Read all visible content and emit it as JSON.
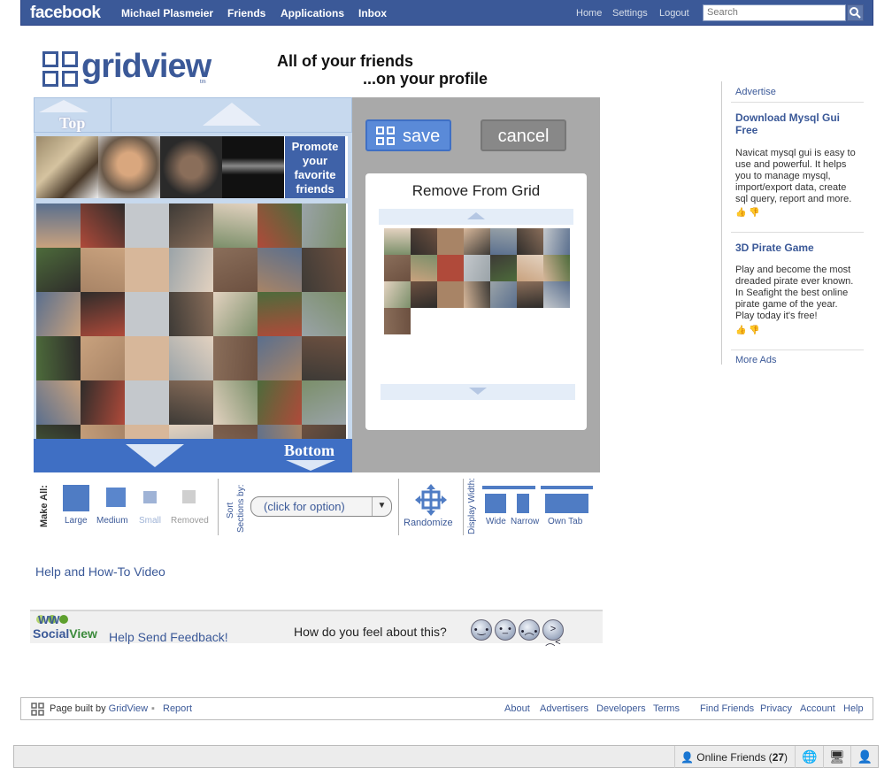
{
  "topbar": {
    "logo": "facebook",
    "nav": [
      "Michael Plasmeier",
      "Friends",
      "Applications",
      "Inbox"
    ],
    "right_nav": [
      "Home",
      "Settings",
      "Logout"
    ],
    "search_placeholder": "Search"
  },
  "app": {
    "logo_text": "gridview",
    "tm": "tm",
    "slogan_line1": "All of your friends",
    "slogan_line2": "...on your profile",
    "top_label": "Top",
    "bottom_label": "Bottom",
    "promote_text": "Promote your favorite friends",
    "save_label": "save",
    "cancel_label": "cancel",
    "remove_title": "Remove From Grid"
  },
  "controls": {
    "make_all_label": "Make All:",
    "sizes": [
      "Large",
      "Medium",
      "Small",
      "Removed"
    ],
    "sort_label_1": "Sort",
    "sort_label_2": "Sections by:",
    "sort_select": "(click for option)",
    "randomize_label": "Randomize",
    "display_width_label": "Display Width:",
    "widths": [
      "Wide",
      "Narrow",
      "Own Tab"
    ]
  },
  "help_link": "Help and How-To Video",
  "feedback": {
    "brand_social": "Social",
    "brand_view": "View",
    "help_text": "Help Send Feedback!",
    "question": "How do you feel about this?",
    "faces": [
      "happy-face-icon",
      "neutral-face-icon",
      "sad-face-icon",
      "angry-face-icon"
    ]
  },
  "sidebar": {
    "advertise": "Advertise",
    "ads": [
      {
        "title": "Download Mysql Gui Free",
        "body": "Navicat mysql gui is easy to use and powerful. It helps you to manage mysql, import/export data, create sql query, report and more."
      },
      {
        "title": "3D Pirate Game",
        "body": "Play and become the most dreaded pirate ever known. In Seafight the best online pirate game of the year. Play today it's free!"
      }
    ],
    "more_ads": "More Ads"
  },
  "footer": {
    "built_prefix": "Page built by",
    "built_link": "GridView",
    "report": "Report",
    "links": [
      "About",
      "Advertisers",
      "Developers",
      "Terms",
      "Find Friends",
      "Privacy",
      "Account",
      "Help"
    ]
  },
  "chat": {
    "online_label": "Online Friends",
    "online_count": "27"
  },
  "colors": {
    "facebook_blue": "#3b5998",
    "grid_light_blue": "#c7d9ee",
    "accent_blue": "#3f6fc4"
  }
}
